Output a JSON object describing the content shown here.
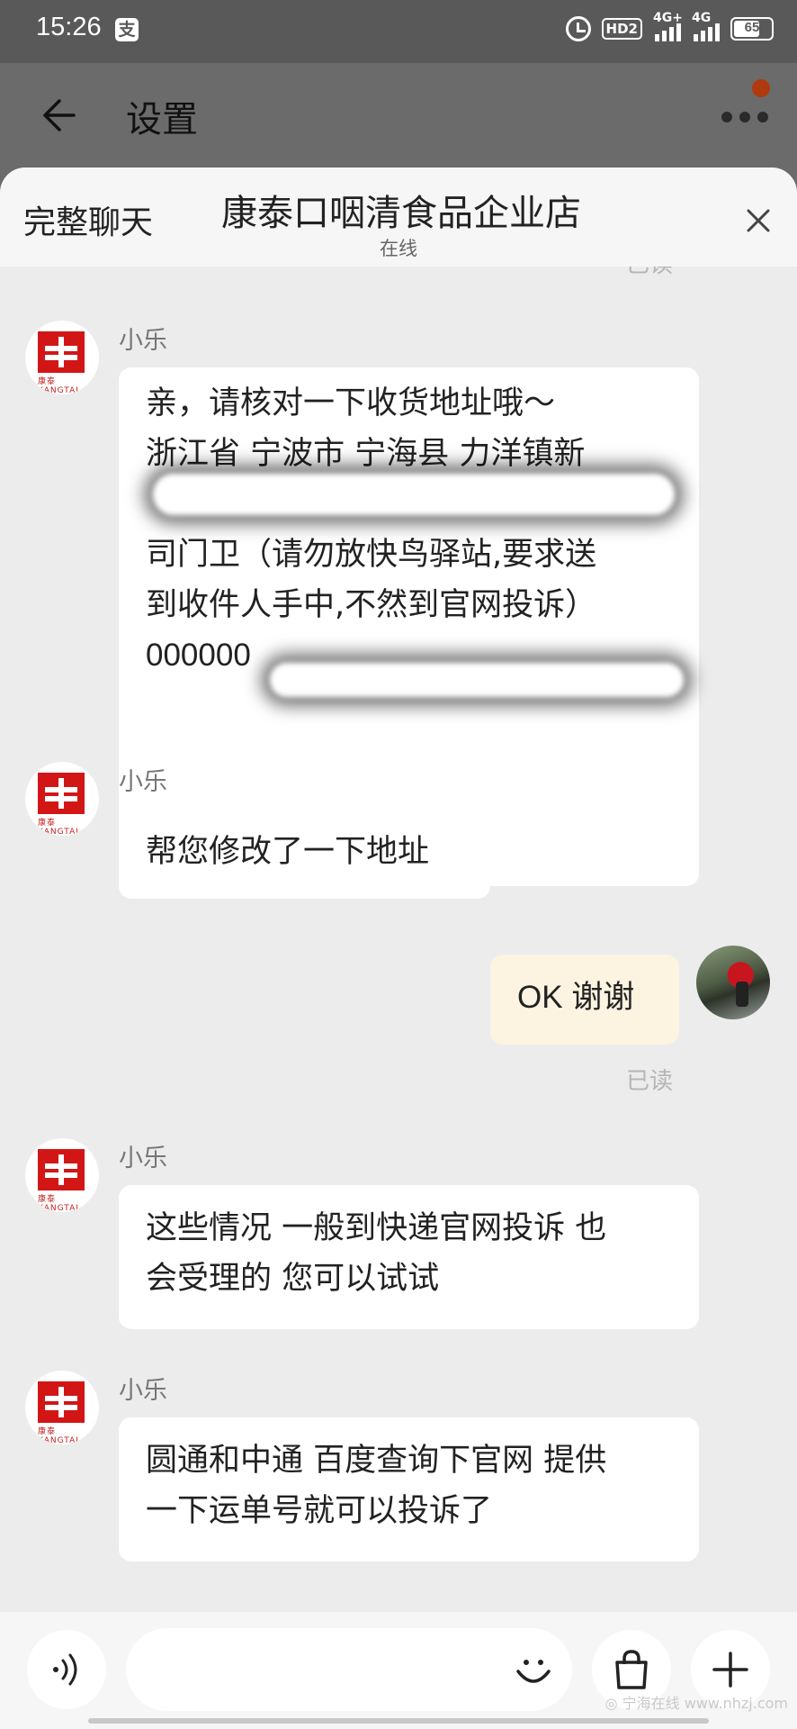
{
  "statusbar": {
    "time": "15:26",
    "pay_icon": "支",
    "hd_label": "HD2",
    "net1": "4G+",
    "net2": "4G",
    "battery": "65"
  },
  "settings": {
    "title": "设置",
    "notification_dot_color": "#b03a10"
  },
  "sheet": {
    "left_label": "完整聊天",
    "shop_name": "康泰口咽清食品企业店",
    "shop_status": "在线",
    "cutoff_read": "已读"
  },
  "messages": [
    {
      "sender": "小乐",
      "side": "left",
      "lines": [
        "亲，请核对一下收货地址哦～",
        "浙江省  宁波市  宁海县  力洋镇新",
        "",
        "司门卫（请勿放快鸟驿站,要求送",
        "到收件人手中,不然到官网投诉）",
        "000000"
      ]
    },
    {
      "sender": "小乐",
      "side": "left",
      "lines": [
        "帮您修改了一下地址"
      ]
    },
    {
      "sender": "",
      "side": "right",
      "lines": [
        "OK  谢谢"
      ],
      "read": "已读"
    },
    {
      "sender": "小乐",
      "side": "left",
      "lines": [
        "这些情况 一般到快递官网投诉 也",
        "会受理的 您可以试试"
      ]
    },
    {
      "sender": "小乐",
      "side": "left",
      "lines": [
        "圆通和中通 百度查询下官网 提供",
        "一下运单号就可以投诉了"
      ]
    }
  ],
  "icons": {
    "back": "back-arrow-icon",
    "more": "more-icon",
    "close": "close-icon",
    "voice": "voice-icon",
    "emoji": "emoji-icon",
    "bag": "shopping-bag-icon",
    "plus": "plus-icon"
  },
  "watermark": "◎ 宁海在线 www.nhzj.com"
}
